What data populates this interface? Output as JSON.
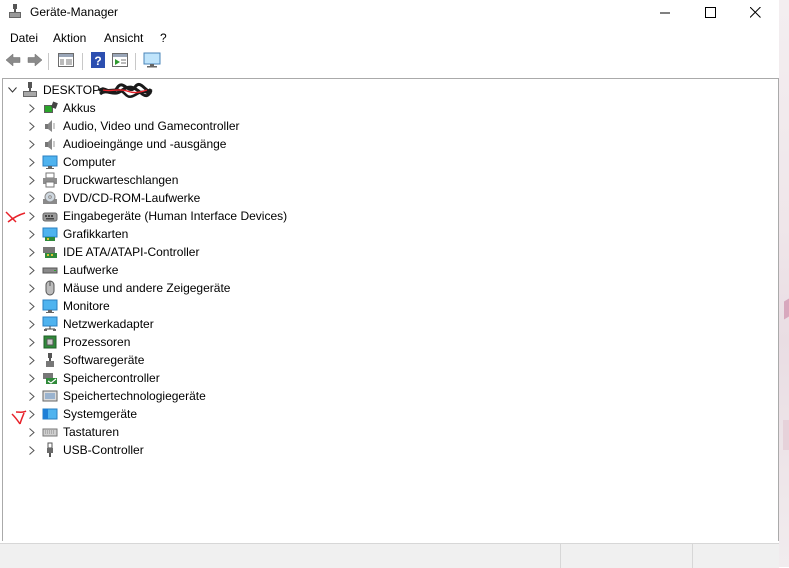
{
  "window": {
    "title": "Geräte-Manager"
  },
  "menu": [
    "Datei",
    "Aktion",
    "Ansicht",
    "?"
  ],
  "toolbar": {
    "buttons": [
      "back-icon",
      "forward-icon",
      "properties-icon",
      "help-icon",
      "run-icon",
      "monitor-icon"
    ]
  },
  "tree": {
    "root": {
      "label": "DESKTOP-",
      "icon": "computer-icon"
    },
    "items": [
      {
        "label": "Akkus",
        "icon": "battery-icon"
      },
      {
        "label": "Audio, Video und Gamecontroller",
        "icon": "speaker-icon"
      },
      {
        "label": "Audioeingänge und -ausgänge",
        "icon": "speaker-icon"
      },
      {
        "label": "Computer",
        "icon": "monitor-icon"
      },
      {
        "label": "Druckwarteschlangen",
        "icon": "printer-icon"
      },
      {
        "label": "DVD/CD-ROM-Laufwerke",
        "icon": "disc-drive-icon"
      },
      {
        "label": "Eingabegeräte (Human Interface Devices)",
        "icon": "hid-icon"
      },
      {
        "label": "Grafikkarten",
        "icon": "display-adapter-icon"
      },
      {
        "label": "IDE ATA/ATAPI-Controller",
        "icon": "ide-controller-icon"
      },
      {
        "label": "Laufwerke",
        "icon": "disk-icon"
      },
      {
        "label": "Mäuse und andere Zeigegeräte",
        "icon": "mouse-icon"
      },
      {
        "label": "Monitore",
        "icon": "monitor-icon"
      },
      {
        "label": "Netzwerkadapter",
        "icon": "network-icon"
      },
      {
        "label": "Prozessoren",
        "icon": "processor-icon"
      },
      {
        "label": "Softwaregeräte",
        "icon": "software-device-icon"
      },
      {
        "label": "Speichercontroller",
        "icon": "storage-controller-icon"
      },
      {
        "label": "Speichertechnologiegeräte",
        "icon": "memory-tech-icon"
      },
      {
        "label": "Systemgeräte",
        "icon": "system-device-icon"
      },
      {
        "label": "Tastaturen",
        "icon": "keyboard-icon"
      },
      {
        "label": "USB-Controller",
        "icon": "usb-icon"
      }
    ]
  },
  "colors": {
    "annotation": "#e8222a",
    "redaction": "#1a1a1a",
    "accent": "#1e7fd6"
  }
}
